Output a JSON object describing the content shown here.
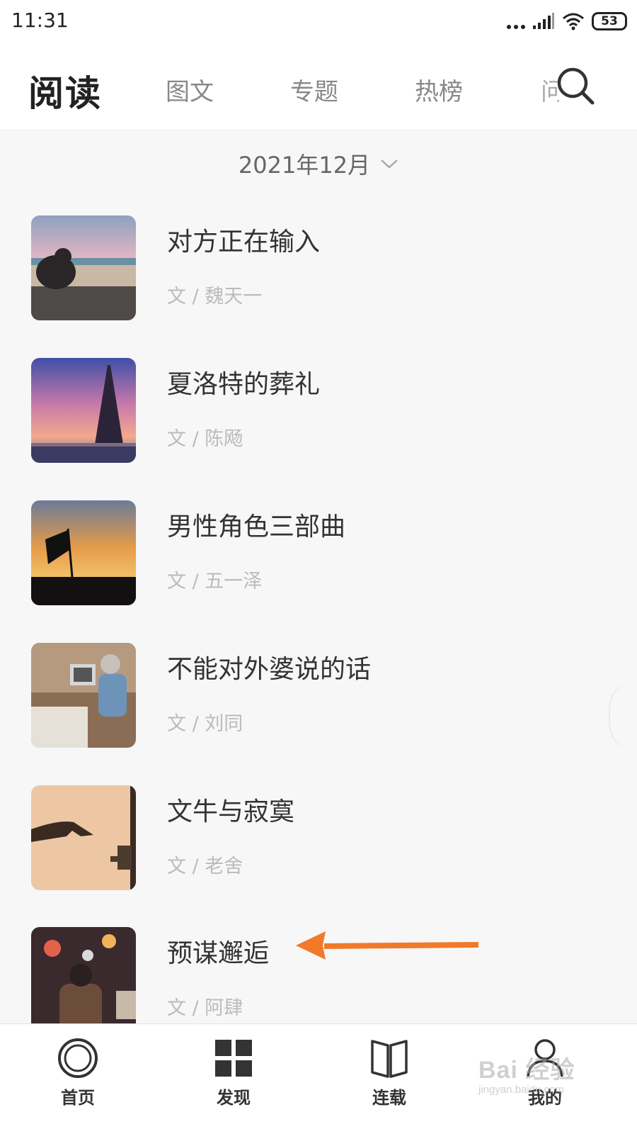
{
  "status_bar": {
    "time": "11:31",
    "battery": "53"
  },
  "header": {
    "title": "阅读",
    "tabs": [
      "图文",
      "专题",
      "热榜"
    ],
    "partial_tab": "问答"
  },
  "month_selector": {
    "label": "2021年12月"
  },
  "articles": [
    {
      "title": "对方正在输入",
      "author": "文 / 魏天一"
    },
    {
      "title": "夏洛特的葬礼",
      "author": "文 / 陈飏"
    },
    {
      "title": "男性角色三部曲",
      "author": "文 / 五一泽"
    },
    {
      "title": "不能对外婆说的话",
      "author": "文 / 刘同"
    },
    {
      "title": "文牛与寂寞",
      "author": "文 / 老舍"
    },
    {
      "title": "预谋邂逅",
      "author": "文 / 阿肆"
    }
  ],
  "annotation": {
    "color": "#f07a2a"
  },
  "bottom_nav": {
    "items": [
      {
        "label": "首页",
        "icon": "home-ring-icon"
      },
      {
        "label": "发现",
        "icon": "grid-icon"
      },
      {
        "label": "连载",
        "icon": "book-icon"
      },
      {
        "label": "我的",
        "icon": "user-icon"
      }
    ]
  },
  "watermark": {
    "main": "Bai 经验",
    "sub": "jingyan.baidu.com"
  }
}
